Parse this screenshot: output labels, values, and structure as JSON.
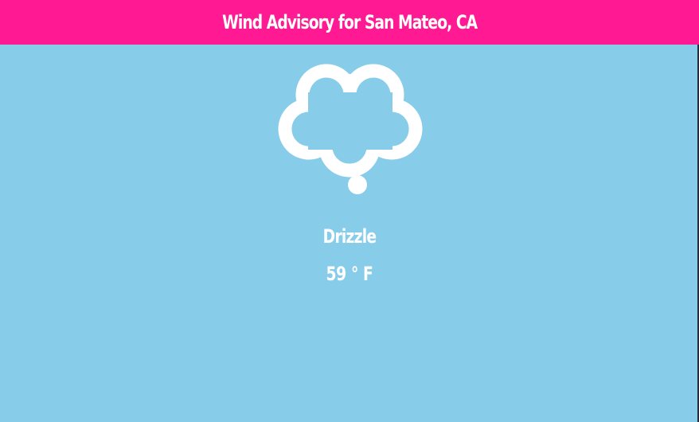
{
  "header": {
    "title": "Wind Advisory for San Mateo, CA"
  },
  "weather": {
    "condition": "Drizzle",
    "temperature": "59 ° F",
    "icon": "drizzle-cloud-icon"
  },
  "colors": {
    "header_background": "#ff1993",
    "page_background": "#87cdea",
    "text": "#ffffff",
    "icon": "#ffffff"
  }
}
